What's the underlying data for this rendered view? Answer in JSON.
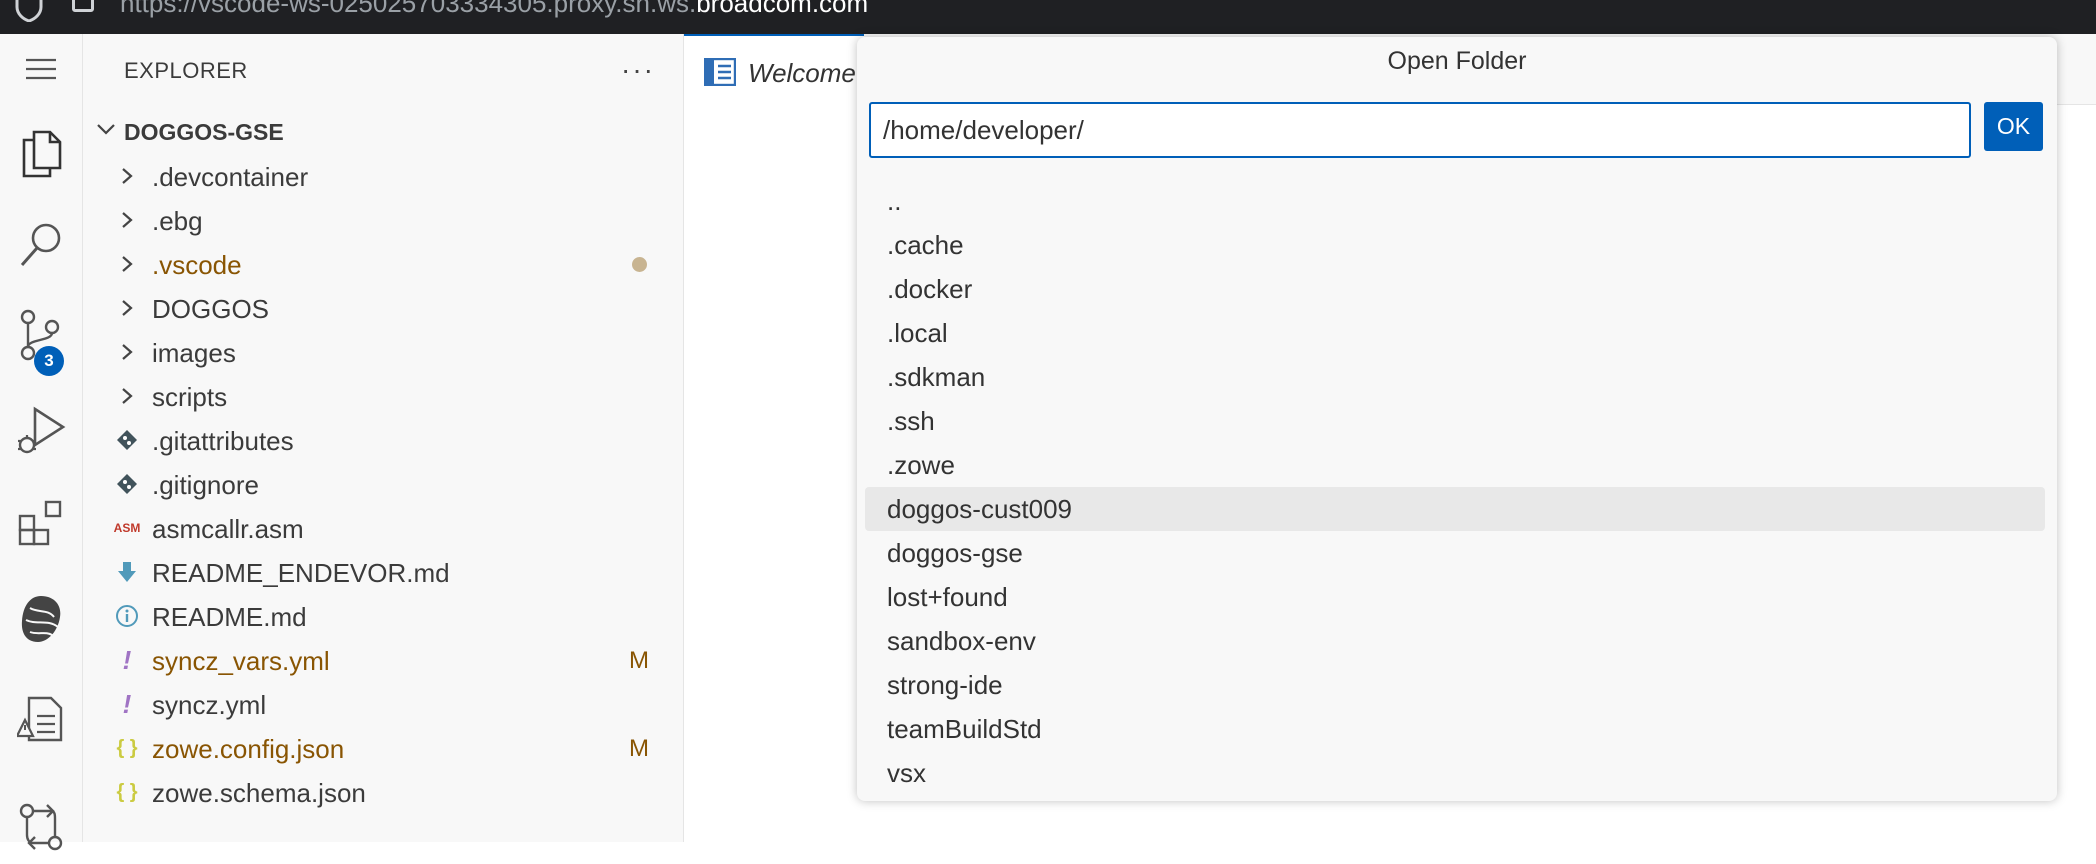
{
  "browser": {
    "url_prefix": "https://vscode-ws-025025703334305.proxy.sh.ws.",
    "url_domain": "broadcom.com"
  },
  "activity_bar": {
    "items": [
      {
        "icon": "hamburger-menu-icon"
      },
      {
        "icon": "files-explorer-icon"
      },
      {
        "icon": "search-icon"
      },
      {
        "icon": "source-control-icon",
        "badge": "3"
      },
      {
        "icon": "run-debug-icon"
      },
      {
        "icon": "extensions-icon"
      },
      {
        "icon": "zowe-explorer-icon"
      },
      {
        "icon": "problems-report-icon"
      },
      {
        "icon": "remote-compare-icon"
      }
    ]
  },
  "sidebar": {
    "title": "EXPLORER",
    "more": "···",
    "root": "DOGGOS-GSE",
    "items": [
      {
        "name": ".devcontainer",
        "folder": true
      },
      {
        "name": ".ebg",
        "folder": true
      },
      {
        "name": ".vscode",
        "folder": true,
        "modified": true
      },
      {
        "name": "DOGGOS",
        "folder": true
      },
      {
        "name": "images",
        "folder": true
      },
      {
        "name": "scripts",
        "folder": true
      },
      {
        "name": ".gitattributes",
        "icon": "git-file-icon"
      },
      {
        "name": ".gitignore",
        "icon": "git-file-icon"
      },
      {
        "name": "asmcallr.asm",
        "icon": "asm-file-icon",
        "icon_text": "ASM"
      },
      {
        "name": "README_ENDEVOR.md",
        "icon": "markdown-download-icon"
      },
      {
        "name": "README.md",
        "icon": "info-icon"
      },
      {
        "name": "syncz_vars.yml",
        "icon": "yaml-icon",
        "icon_text": "!",
        "modified": true,
        "status": "M"
      },
      {
        "name": "syncz.yml",
        "icon": "yaml-icon",
        "icon_text": "!"
      },
      {
        "name": "zowe.config.json",
        "icon": "json-icon",
        "icon_text": "{ }",
        "modified": true,
        "status": "M"
      },
      {
        "name": "zowe.schema.json",
        "icon": "json-icon",
        "icon_text": "{ }"
      }
    ]
  },
  "editor": {
    "tab_label": "Welcome"
  },
  "dialog": {
    "title": "Open Folder",
    "input_value": "/home/developer/",
    "ok_label": "OK",
    "items": [
      "..",
      ".cache",
      ".docker",
      ".local",
      ".sdkman",
      ".ssh",
      ".zowe",
      "doggos-cust009",
      "doggos-gse",
      "lost+found",
      "sandbox-env",
      "strong-ide",
      "teamBuildStd",
      "vsx"
    ],
    "focused_index": 7
  },
  "colors": {
    "accent": "#005fb8",
    "modified": "#895503",
    "yaml_icon": "#a074c4",
    "json_icon": "#cbcb41"
  }
}
